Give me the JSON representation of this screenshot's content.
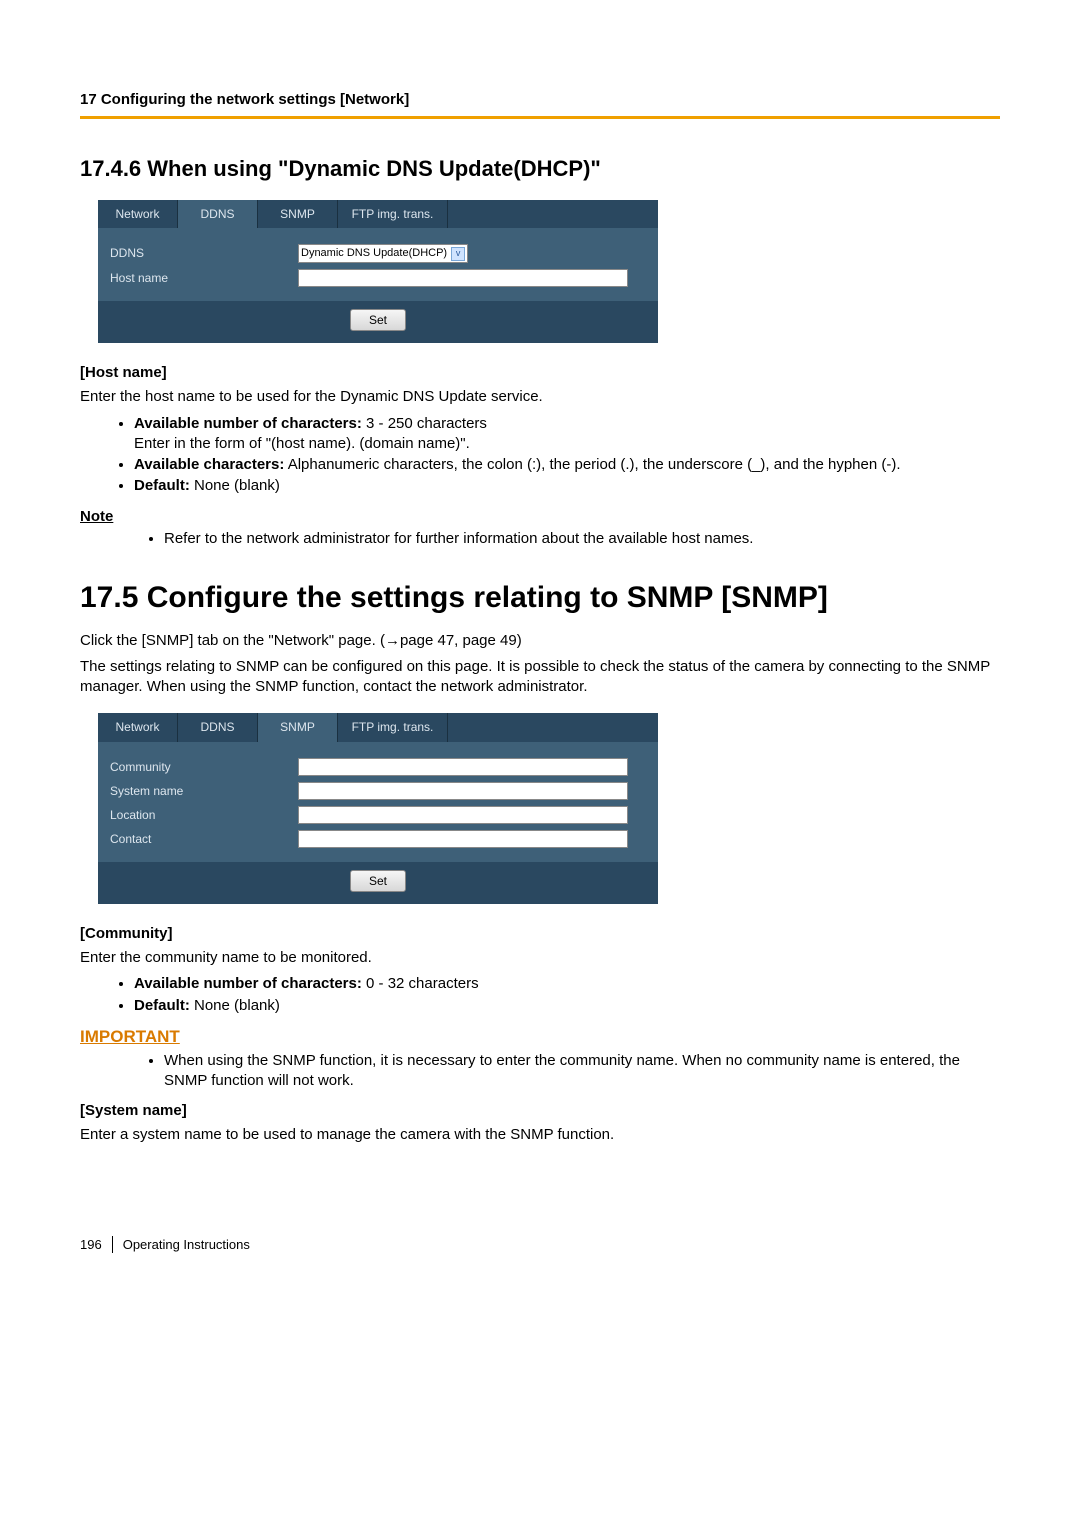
{
  "header": {
    "breadcrumb": "17 Configuring the network settings [Network]"
  },
  "sec1746": {
    "heading": "17.4.6  When using \"Dynamic DNS Update(DHCP)\"",
    "ui": {
      "tabs": [
        "Network",
        "DDNS",
        "SNMP",
        "FTP img. trans."
      ],
      "active_tab": "DDNS",
      "rows": {
        "ddns_label": "DDNS",
        "ddns_select": "Dynamic DNS Update(DHCP)",
        "host_label": "Host name"
      },
      "set_button": "Set"
    },
    "hostname_title": "[Host name]",
    "hostname_desc": "Enter the host name to be used for the Dynamic DNS Update service.",
    "b1_label": "Available number of characters:",
    "b1_text": " 3 - 250 characters",
    "b1_sub": "Enter in the form of \"(host name). (domain name)\".",
    "b2_label": "Available characters:",
    "b2_text": " Alphanumeric characters, the colon (:), the period (.), the underscore (_), and the hyphen (-).",
    "b3_label": "Default:",
    "b3_text": " None (blank)",
    "note_label": "Note",
    "note_text": "Refer to the network administrator for further information about the available host names."
  },
  "sec175": {
    "heading": "17.5  Configure the settings relating to SNMP [SNMP]",
    "intro1": "Click the [SNMP] tab on the \"Network\" page. (→page 47, page 49)",
    "intro2": "The settings relating to SNMP can be configured on this page. It is possible to check the status of the camera by connecting to the SNMP manager. When using the SNMP function, contact the network administrator.",
    "ui": {
      "tabs": [
        "Network",
        "DDNS",
        "SNMP",
        "FTP img. trans."
      ],
      "active_tab": "SNMP",
      "rows": {
        "community": "Community",
        "system": "System name",
        "location": "Location",
        "contact": "Contact"
      },
      "set_button": "Set"
    },
    "community_title": "[Community]",
    "community_desc": "Enter the community name to be monitored.",
    "c1_label": "Available number of characters:",
    "c1_text": " 0 - 32 characters",
    "c2_label": "Default:",
    "c2_text": " None (blank)",
    "important_label": "IMPORTANT",
    "important_text": "When using the SNMP function, it is necessary to enter the community name. When no community name is entered, the SNMP function will not work.",
    "system_title": "[System name]",
    "system_desc": "Enter a system name to be used to manage the camera with the SNMP function."
  },
  "footer": {
    "page": "196",
    "doc": "Operating Instructions"
  }
}
